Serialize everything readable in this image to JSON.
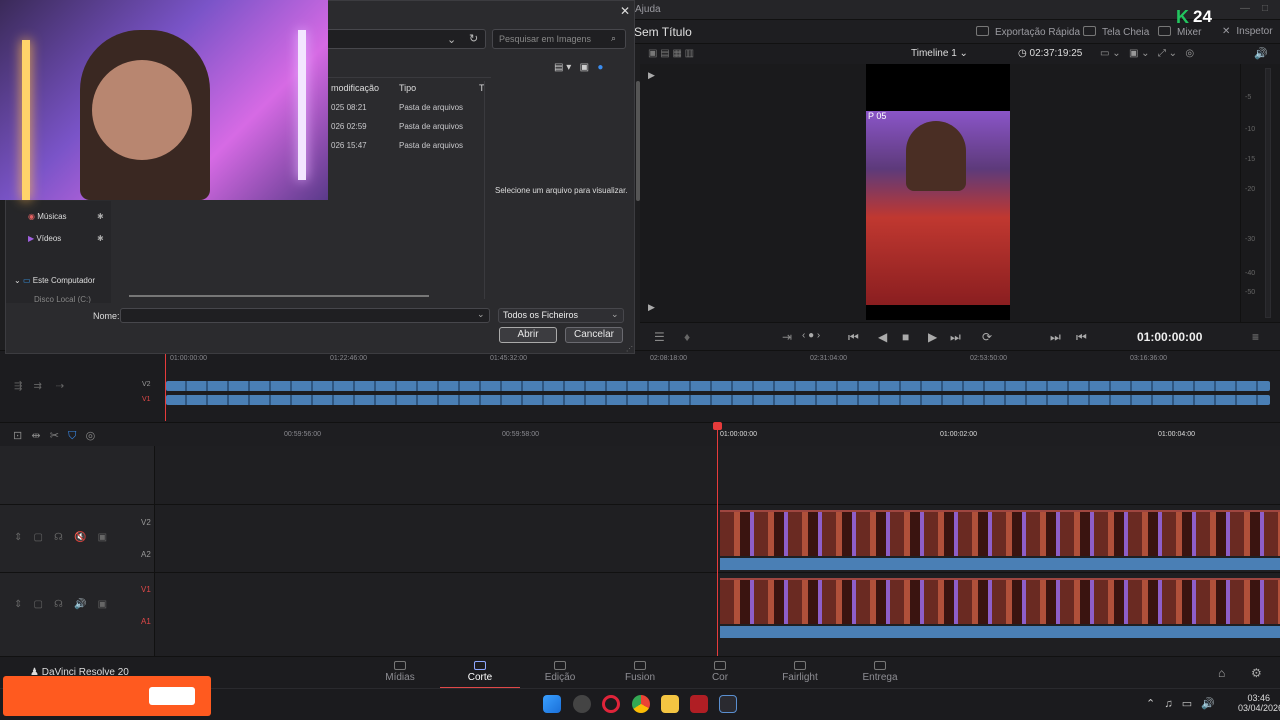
{
  "menu": {
    "help": "Ajuda"
  },
  "header": {
    "project_title": "Sem Título",
    "quick_export": "Exportação Rápida",
    "full_screen": "Tela Cheia",
    "mixer": "Mixer",
    "inspector": "Inspetor"
  },
  "overlay_badge": {
    "number": "24"
  },
  "viewer": {
    "timeline_name": "Timeline 1",
    "source_timecode": "02:37:19:25",
    "frame_text": "P 05",
    "current_timecode": "01:00:00:00"
  },
  "meter_scale": [
    "-5",
    "-10",
    "-15",
    "-20",
    "-30",
    "-40",
    "-50"
  ],
  "upper_timeline": {
    "ruler": [
      "01:00:00:00",
      "01:22:46:00",
      "01:45:32:00",
      "02:08:18:00",
      "02:31:04:00",
      "02:53:50:00",
      "03:16:36:00"
    ],
    "tracks": [
      "V2",
      "V1"
    ]
  },
  "lower_timeline": {
    "ruler": [
      "00:59:56:00",
      "00:59:58:00",
      "01:00:00:00",
      "01:00:02:00",
      "01:00:04:00"
    ],
    "track_labels": {
      "v2": "V2",
      "a2": "A2",
      "v1": "V1",
      "a1": "A1"
    }
  },
  "pages": [
    {
      "label": "Mídias"
    },
    {
      "label": "Corte"
    },
    {
      "label": "Edição"
    },
    {
      "label": "Fusion"
    },
    {
      "label": "Cor"
    },
    {
      "label": "Fairlight"
    },
    {
      "label": "Entrega"
    }
  ],
  "app_name": "DaVinci Resolve 20",
  "dialog": {
    "search_placeholder": "Pesquisar em Imagens",
    "columns": {
      "modified": "modificação",
      "type": "Tipo",
      "extra": "T"
    },
    "files": [
      {
        "date": "025 08:21",
        "type": "Pasta de arquivos"
      },
      {
        "date": "026 02:59",
        "type": "Pasta de arquivos"
      },
      {
        "date": "026 15:47",
        "type": "Pasta de arquivos"
      }
    ],
    "preview_hint": "Selecione um arquivo para visualizar.",
    "nav": {
      "music": "Músicas",
      "videos": "Vídeos",
      "this_pc": "Este Computador",
      "drive": "Disco Local (C:)"
    },
    "name_label": "Nome:",
    "name_value": "",
    "filter": "Todos os Ficheiros",
    "open": "Abrir",
    "cancel": "Cancelar"
  },
  "clock": {
    "time": "03:46",
    "date": "03/04/2026"
  },
  "colors": {
    "accent": "#e04848",
    "clip_blue": "#4a7fb5",
    "overlay_orange": "#ff5a1f",
    "badge_green": "#22c55e"
  }
}
